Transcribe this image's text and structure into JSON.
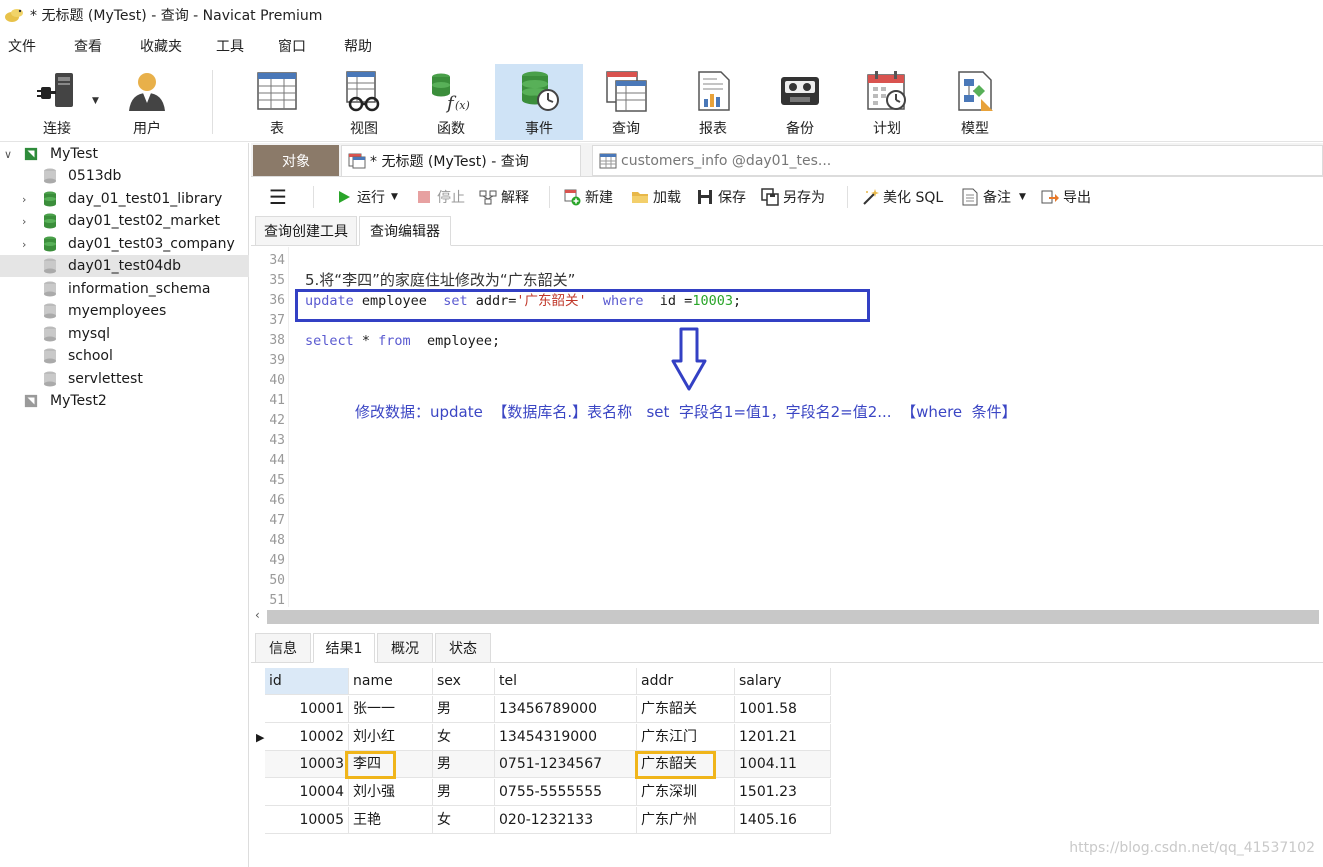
{
  "window": {
    "title": "* 无标题 (MyTest) - 查询 - Navicat Premium"
  },
  "menu": [
    "文件",
    "查看",
    "收藏夹",
    "工具",
    "窗口",
    "帮助"
  ],
  "toolbar": [
    {
      "label": "连接",
      "icon": "connection-icon"
    },
    {
      "label": "用户",
      "icon": "user-icon"
    },
    {
      "label": "表",
      "icon": "table-icon"
    },
    {
      "label": "视图",
      "icon": "view-icon"
    },
    {
      "label": "函数",
      "icon": "function-icon"
    },
    {
      "label": "事件",
      "icon": "event-icon",
      "active": true
    },
    {
      "label": "查询",
      "icon": "query-icon"
    },
    {
      "label": "报表",
      "icon": "report-icon"
    },
    {
      "label": "备份",
      "icon": "backup-icon"
    },
    {
      "label": "计划",
      "icon": "schedule-icon"
    },
    {
      "label": "模型",
      "icon": "model-icon"
    }
  ],
  "tree": [
    {
      "label": "MyTest",
      "level": 0,
      "expanded": true,
      "type": "connection"
    },
    {
      "label": "0513db",
      "level": 1,
      "type": "db-closed"
    },
    {
      "label": "day_01_test01_library",
      "level": 1,
      "type": "db-open",
      "caret": true
    },
    {
      "label": "day01_test02_market",
      "level": 1,
      "type": "db-open",
      "caret": true
    },
    {
      "label": "day01_test03_company",
      "level": 1,
      "type": "db-open",
      "caret": true
    },
    {
      "label": "day01_test04db",
      "level": 1,
      "type": "db-closed",
      "selected": true
    },
    {
      "label": "information_schema",
      "level": 1,
      "type": "db-closed"
    },
    {
      "label": "myemployees",
      "level": 1,
      "type": "db-closed"
    },
    {
      "label": "mysql",
      "level": 1,
      "type": "db-closed"
    },
    {
      "label": "school",
      "level": 1,
      "type": "db-closed"
    },
    {
      "label": "servlettest",
      "level": 1,
      "type": "db-closed"
    },
    {
      "label": "MyTest2",
      "level": 0,
      "type": "connection-off"
    }
  ],
  "tabs": {
    "objects": "对象",
    "query_tab": "* 无标题 (MyTest) - 查询",
    "other_tab": "customers_info @day01_tes..."
  },
  "query_toolbar": {
    "run": "运行",
    "stop": "停止",
    "explain": "解释",
    "new": "新建",
    "load": "加载",
    "save": "保存",
    "save_as": "另存为",
    "beautify": "美化 SQL",
    "note": "备注",
    "export": "导出"
  },
  "sub_tabs": [
    "查询创建工具",
    "查询编辑器"
  ],
  "editor": {
    "line_numbers": [
      "34",
      "35",
      "36",
      "37",
      "38",
      "39",
      "40",
      "41",
      "42",
      "43",
      "44",
      "45",
      "46",
      "47",
      "48",
      "49",
      "50",
      "51"
    ],
    "comment": "5.将“李四”的家庭住址修改为“广东韶关”",
    "update": {
      "kw1": "update",
      "t1": " employee  ",
      "kw2": "set",
      "t2": " addr=",
      "str": "'广东韶关'",
      "t3": "  ",
      "kw3": "where",
      "t4": "  id =",
      "num": "10003",
      "t5": ";"
    },
    "select": {
      "kw1": "select",
      "t1": " * ",
      "kw2": "from",
      "t2": "  employee;"
    },
    "annotation": "修改数据：update  【数据库名.】表名称   set  字段名1=值1，字段名2=值2...  【where  条件】"
  },
  "result_tabs": [
    "信息",
    "结果1",
    "概况",
    "状态"
  ],
  "grid": {
    "columns": [
      "id",
      "name",
      "sex",
      "tel",
      "addr",
      "salary"
    ],
    "rows": [
      [
        "10001",
        "张一一",
        "男",
        "13456789000",
        "广东韶关",
        "1001.58"
      ],
      [
        "10002",
        "刘小红",
        "女",
        "13454319000",
        "广东江门",
        "1201.21"
      ],
      [
        "10003",
        "李四",
        "男",
        "0751-1234567",
        "广东韶关",
        "1004.11"
      ],
      [
        "10004",
        "刘小强",
        "男",
        "0755-5555555",
        "广东深圳",
        "1501.23"
      ],
      [
        "10005",
        "王艳",
        "女",
        "020-1232133",
        "广东广州",
        "1405.16"
      ]
    ]
  },
  "watermark": "https://blog.csdn.net/qq_41537102"
}
